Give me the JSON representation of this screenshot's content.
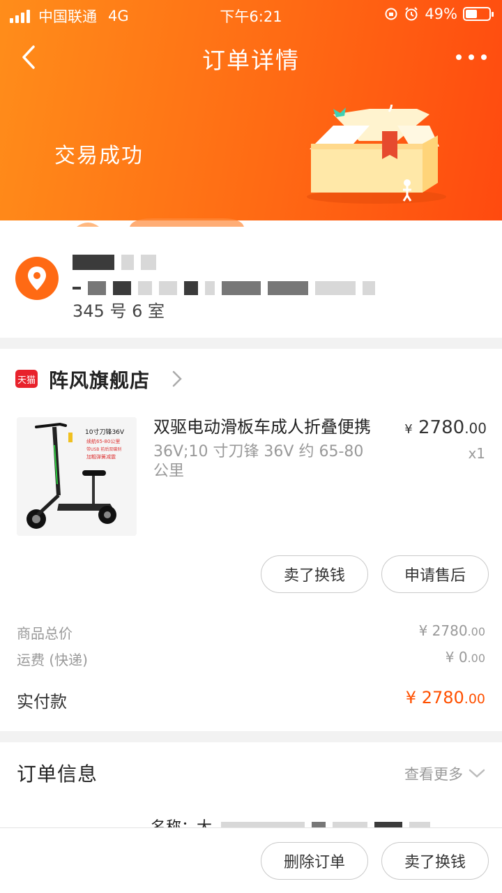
{
  "status_bar": {
    "carrier": "中国联通",
    "network": "4G",
    "time": "下午6:21",
    "battery": "49%",
    "battery_level": 0.49
  },
  "navbar": {
    "title": "订单详情"
  },
  "hero": {
    "status": "交易成功"
  },
  "address": {
    "name_partial": "",
    "line2_partial": "345 号 6 室"
  },
  "shop": {
    "badge": "天猫",
    "name": "阵风旗舰店"
  },
  "product": {
    "title": "双驱电动滑板车成人折叠便携",
    "sku": "36V;10 寸刀锋 36V 约 65-80 公里",
    "price_yen": "¥",
    "price_int": "2780",
    "price_dec": ".00",
    "qty": "x1",
    "image_text": {
      "line1": "10寸刀锋36V",
      "line2": "续航65-80公里",
      "line3": "带USB 前后双碟刹",
      "line4": "加粗弹簧减震"
    }
  },
  "actions": {
    "sell": "卖了换钱",
    "aftersale": "申请售后",
    "delete": "删除订单"
  },
  "summary": {
    "total_label": "商品总价",
    "total_int": "¥ 2780",
    "total_dec": ".00",
    "ship_label": "运费 (快递)",
    "ship_int": "¥ 0",
    "ship_dec": ".00",
    "paid_label": "实付款",
    "paid_int": "¥ 2780",
    "paid_dec": ".00"
  },
  "order_info": {
    "title": "订单信息",
    "view_more": "查看更多",
    "name_label": "名称：大"
  },
  "colors": {
    "accent": "#ff6a14",
    "price": "#ff5000",
    "tmall": "#e8222c"
  }
}
